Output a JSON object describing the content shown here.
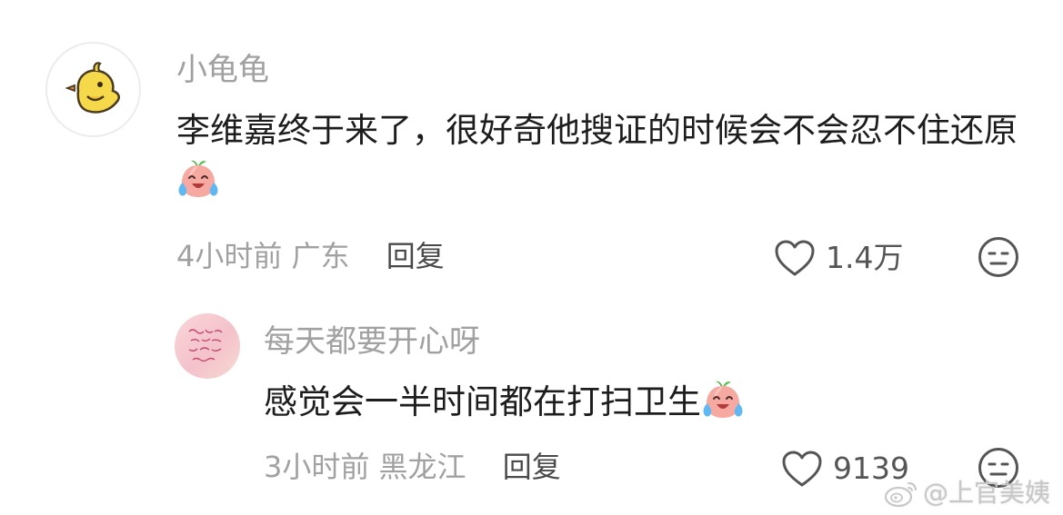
{
  "comments": [
    {
      "avatar_icon": "yellow-chick-icon",
      "username": "小龟龟",
      "text": "李维嘉终于来了，很好奇他搜证的时候会不会忍不住还原",
      "emoji": "crying-peach-emoji",
      "time": "4小时前",
      "location": "广东",
      "reply_label": "回复",
      "likes": "1.4万"
    },
    {
      "avatar_icon": "pink-handwriting-avatar",
      "username": "每天都要开心呀",
      "text": "感觉会一半时间都在打扫卫生",
      "emoji": "crying-peach-emoji",
      "time": "3小时前",
      "location": "黑龙江",
      "reply_label": "回复",
      "likes": "9139"
    }
  ],
  "watermark": {
    "icon": "weibo-logo-icon",
    "text": "@上官美姨"
  },
  "colors": {
    "username": "#a1a1a1",
    "body_text": "#1d1d1d",
    "meta": "#a1a1a1",
    "reply": "#4a4a4a",
    "icon_stroke": "#555555"
  }
}
